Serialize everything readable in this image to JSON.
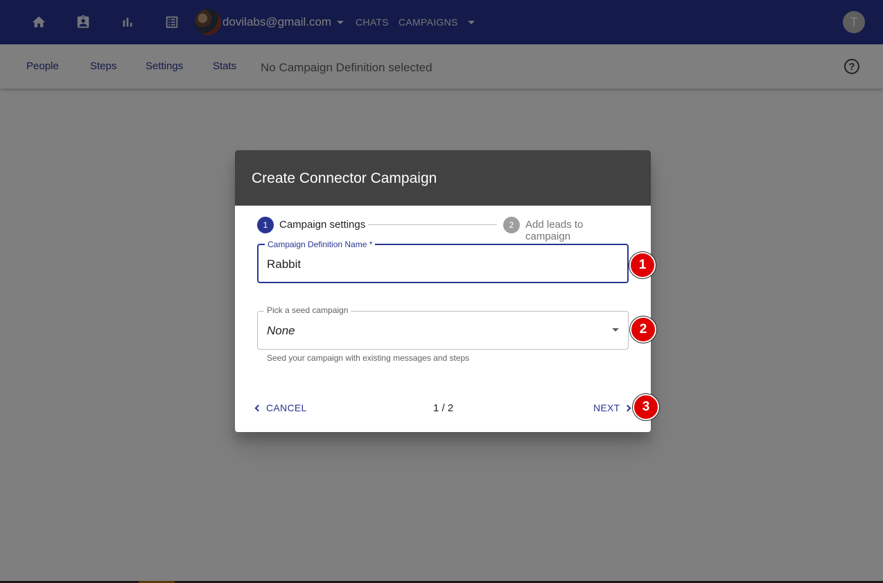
{
  "appbar": {
    "account_email": "dovilabs@gmail.com",
    "links": [
      "CHATS",
      "CAMPAIGNS"
    ],
    "user_initial": "T",
    "icons": [
      "home-icon",
      "assignment-ind-icon",
      "bar-chart-icon",
      "list-icon"
    ]
  },
  "subbar": {
    "tabs": [
      "People",
      "Steps",
      "Settings",
      "Stats"
    ],
    "status": "No Campaign Definition selected",
    "help_icon": "?"
  },
  "dialog": {
    "title": "Create Connector Campaign",
    "steps": [
      {
        "num": "1",
        "label": "Campaign settings"
      },
      {
        "num": "2",
        "label": "Add leads to campaign"
      }
    ],
    "name_field": {
      "label": "Campaign Definition Name *",
      "value": "Rabbit"
    },
    "seed_field": {
      "label": "Pick a seed campaign",
      "value": "None",
      "helper": "Seed your campaign with existing messages and steps"
    },
    "cancel_label": "CANCEL",
    "pager": "1 / 2",
    "next_label": "NEXT"
  },
  "annotations": [
    "1",
    "2",
    "3"
  ],
  "colors": {
    "primary": "#283593",
    "header": "#424242",
    "badge": "#e00000"
  }
}
